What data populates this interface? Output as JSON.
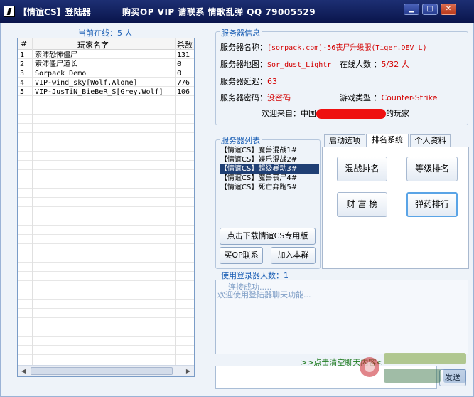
{
  "titlebar": {
    "title": "【情谊CS】登陆器",
    "promo": "购买OP VIP 请联系 情歌乱弹 QQ 79005529",
    "min_glyph": "▁",
    "max_glyph": "□",
    "close_glyph": "✕"
  },
  "online": {
    "title": "当前在线：5 人",
    "columns": [
      "#",
      "玩家名字",
      "杀敌"
    ],
    "players": [
      {
        "num": "1",
        "name": "索沛恐怖僵尸",
        "kills": "131"
      },
      {
        "num": "2",
        "name": "索沛僵尸道长",
        "kills": "0"
      },
      {
        "num": "3",
        "name": "Sorpack Demo",
        "kills": "0"
      },
      {
        "num": "4",
        "name": "VIP-wind_sky[Wolf.Alone]",
        "kills": "776"
      },
      {
        "num": "5",
        "name": "VIP-JusTiN_BieBeR_S[Grey.Wolf]",
        "kills": "106"
      }
    ],
    "scroll_left": "◀",
    "scroll_right": "▶"
  },
  "server_info": {
    "title": "服务器信息",
    "name_label": "服务器名称：",
    "name_value": "[sorpack.com]-56丧尸升级服(Tiger.DEV!L)",
    "map_label": "服务器地图：",
    "map_value": "Sor_dust_Lightr",
    "players_label": "在线人数 ：",
    "players_value": "5/32 人",
    "latency_label": "服务器延迟：",
    "latency_value": "63",
    "password_label": "服务器密码：",
    "password_value": "没密码",
    "gametype_label": "游戏类型 ：",
    "gametype_value": "Counter-Strike",
    "welcome_prefix": "欢迎来自：中国",
    "welcome_suffix": "的玩家"
  },
  "server_list": {
    "title": "服务器列表",
    "items": [
      "【情谊CS】魔兽混战1#",
      "【情谊CS】娱乐混战2#",
      "【情谊CS】超级暴动3#",
      "【情谊CS】魔兽丧尸4#",
      "【情谊CS】死亡奔跑5#"
    ],
    "selected_index": 2,
    "download_button": "点击下载情谊CS专用版",
    "buy_op_button": "买OP联系",
    "join_group_button": "加入本群"
  },
  "tabs": {
    "labels": [
      "启动选项",
      "排名系统",
      "个人资料"
    ],
    "active_index": 1,
    "ranking_buttons": [
      "混战排名",
      "等级排名",
      "财 富 榜",
      "弹药排行"
    ]
  },
  "chat": {
    "title": "使用登录器人数：1",
    "lines": [
      "连接成功.....",
      "欢迎使用登陆器聊天功能..."
    ],
    "clear_link": ">>点击清空聊天内容<",
    "send_button": "发送",
    "input_value": ""
  },
  "colors": {
    "accent": "#1b5fb5",
    "value_red": "#d40000",
    "selected_row": "#1f3f74",
    "titlebar": "#0a154c"
  }
}
